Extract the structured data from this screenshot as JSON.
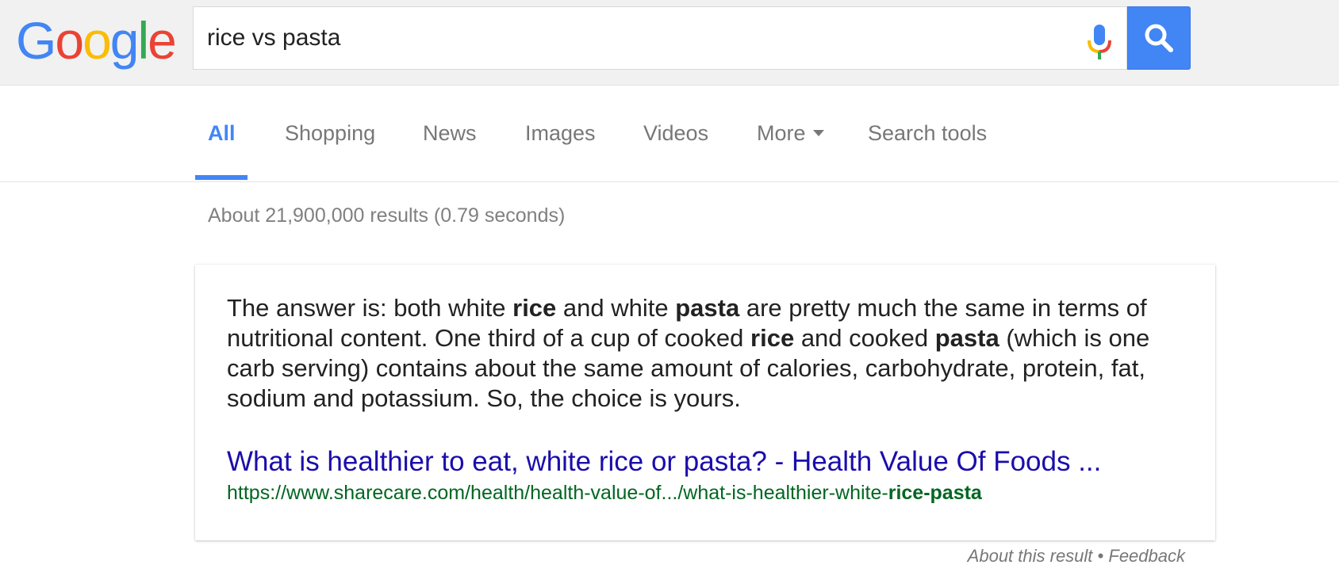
{
  "logo": {
    "letters": [
      "G",
      "o",
      "o",
      "g",
      "l",
      "e"
    ],
    "colors": [
      "#4285f4",
      "#ea4335",
      "#fbbc05",
      "#4285f4",
      "#34a853",
      "#ea4335"
    ]
  },
  "search": {
    "query": "rice vs pasta"
  },
  "tabs": [
    {
      "label": "All",
      "active": true
    },
    {
      "label": "Shopping"
    },
    {
      "label": "News"
    },
    {
      "label": "Images"
    },
    {
      "label": "Videos"
    },
    {
      "label": "More"
    },
    {
      "label": "Search tools"
    }
  ],
  "stats": "About 21,900,000 results (0.79 seconds)",
  "snippet": {
    "answer_parts": [
      {
        "text": "The answer is: both white ",
        "bold": false
      },
      {
        "text": "rice",
        "bold": true
      },
      {
        "text": " and white ",
        "bold": false
      },
      {
        "text": "pasta",
        "bold": true
      },
      {
        "text": " are pretty much the same in terms of nutritional content. One third of a cup of cooked ",
        "bold": false
      },
      {
        "text": "rice",
        "bold": true
      },
      {
        "text": " and cooked ",
        "bold": false
      },
      {
        "text": "pasta",
        "bold": true
      },
      {
        "text": " (which is one carb serving) contains about the same amount of calories, carbohydrate, protein, fat, sodium and potassium. So, the choice is yours.",
        "bold": false
      }
    ],
    "title": "What is healthier to eat, white rice or pasta? - Health Value Of Foods ...",
    "url_prefix": "https://www.sharecare.com/health/health-value-of.../what-is-healthier-white-",
    "url_bold": "rice-pasta"
  },
  "footer": {
    "about": "About this result",
    "separator": "•",
    "feedback": "Feedback"
  },
  "colors": {
    "accent": "#4285f4",
    "link": "#1a0dab",
    "url": "#006621"
  }
}
